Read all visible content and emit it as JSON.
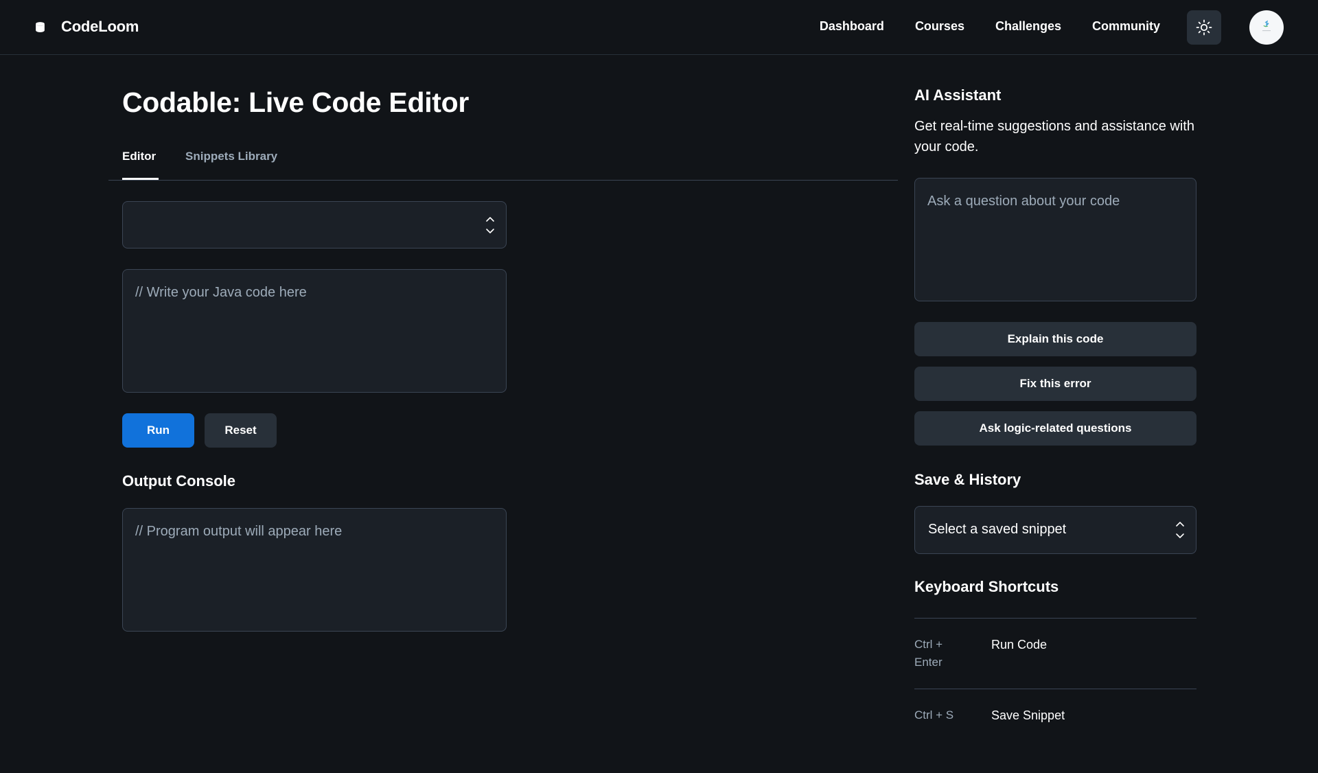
{
  "app": {
    "name": "CodeLoom"
  },
  "nav": {
    "items": [
      "Dashboard",
      "Courses",
      "Challenges",
      "Community"
    ]
  },
  "icons": {
    "brand": "database-icon",
    "theme": "sun-icon",
    "avatar": "user-avatar"
  },
  "page": {
    "title": "Codable: Live Code Editor",
    "tabs": [
      {
        "label": "Editor",
        "active": true
      },
      {
        "label": "Snippets Library",
        "active": false
      }
    ]
  },
  "editor": {
    "language_value": "",
    "code_placeholder": "// Write your Java code here",
    "run_label": "Run",
    "reset_label": "Reset"
  },
  "output": {
    "title": "Output Console",
    "placeholder": "// Program output will appear here"
  },
  "assistant": {
    "title": "AI Assistant",
    "description": "Get real-time suggestions and assistance with your code.",
    "question_placeholder": "Ask a question about your code",
    "buttons": [
      "Explain this code",
      "Fix this error",
      "Ask logic-related questions"
    ]
  },
  "history": {
    "title": "Save & History",
    "select_value": "Select a saved snippet"
  },
  "shortcuts": {
    "title": "Keyboard Shortcuts",
    "items": [
      {
        "key_line1": "Ctrl +",
        "key_line2": "Enter",
        "action": "Run Code"
      },
      {
        "key_line1": "Ctrl + S",
        "key_line2": "",
        "action": "Save Snippet"
      }
    ]
  },
  "colors": {
    "background": "#111418",
    "surface": "#1b2027",
    "border": "#3b4554",
    "muted_text": "#9dabb9",
    "primary": "#1172db",
    "secondary_button": "#283039"
  }
}
